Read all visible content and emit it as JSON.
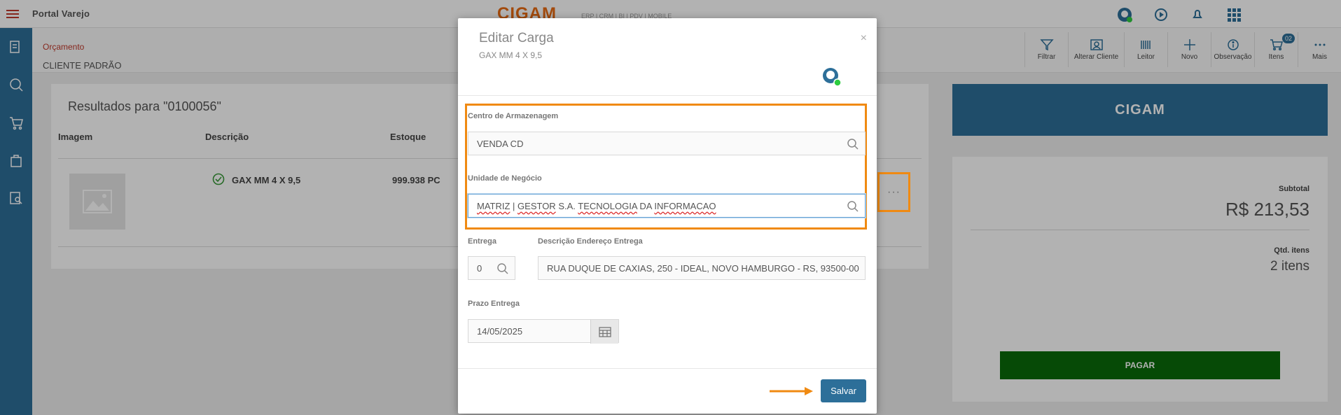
{
  "app": {
    "title": "Portal Varejo",
    "brand": "CIGAM",
    "brand_sub": "ERP | CRM | BI | PDV | MOBILE"
  },
  "subheader": {
    "breadcrumb": "Orçamento",
    "client": "CLIENTE PADRÃO"
  },
  "toolbar": {
    "items": [
      {
        "label": "Filtrar",
        "icon": "filter-icon"
      },
      {
        "label": "Alterar Cliente",
        "icon": "user-card-icon"
      },
      {
        "label": "Leitor",
        "icon": "barcode-icon"
      },
      {
        "label": "Novo",
        "icon": "plus-icon"
      },
      {
        "label": "Observação",
        "icon": "info-icon"
      },
      {
        "label": "Itens",
        "icon": "cart-icon",
        "badge": "02"
      },
      {
        "label": "Mais",
        "icon": "more-icon"
      }
    ]
  },
  "results": {
    "title": "Resultados para \"0100056\"",
    "columns": [
      "Imagem",
      "Descrição",
      "Estoque"
    ],
    "row": {
      "description": "GAX MM 4 X 9,5",
      "stock": "999.938 PC"
    },
    "more": "···"
  },
  "summary": {
    "logo": "CIGAM",
    "subtotal_label": "Subtotal",
    "subtotal_value": "R$ 213,53",
    "qty_label": "Qtd. itens",
    "qty_value": "2 itens",
    "pay_label": "PAGAR"
  },
  "modal": {
    "title": "Editar Carga",
    "subtitle": "GAX MM 4 X 9,5",
    "close": "×",
    "warehouse_label": "Centro de Armazenagem",
    "warehouse_value": "VENDA CD",
    "business_unit_label": "Unidade de Negócio",
    "business_unit_value_parts": [
      "MATRIZ",
      " | ",
      "GESTOR",
      " S.A. ",
      "TECNOLOGIA",
      " DA ",
      "INFORMACAO"
    ],
    "delivery_label": "Entrega",
    "delivery_value": "0",
    "address_label": "Descrição Endereço Entrega",
    "address_value": "RUA DUQUE DE CAXIAS, 250 - IDEAL, NOVO HAMBURGO - RS, 93500-00",
    "deadline_label": "Prazo Entrega",
    "deadline_value": "14/05/2025",
    "save_label": "Salvar"
  },
  "colors": {
    "primary": "#2d6f99",
    "highlight": "#f08a12",
    "pay": "#0a6b0a",
    "breadcrumb": "#c0392b"
  }
}
